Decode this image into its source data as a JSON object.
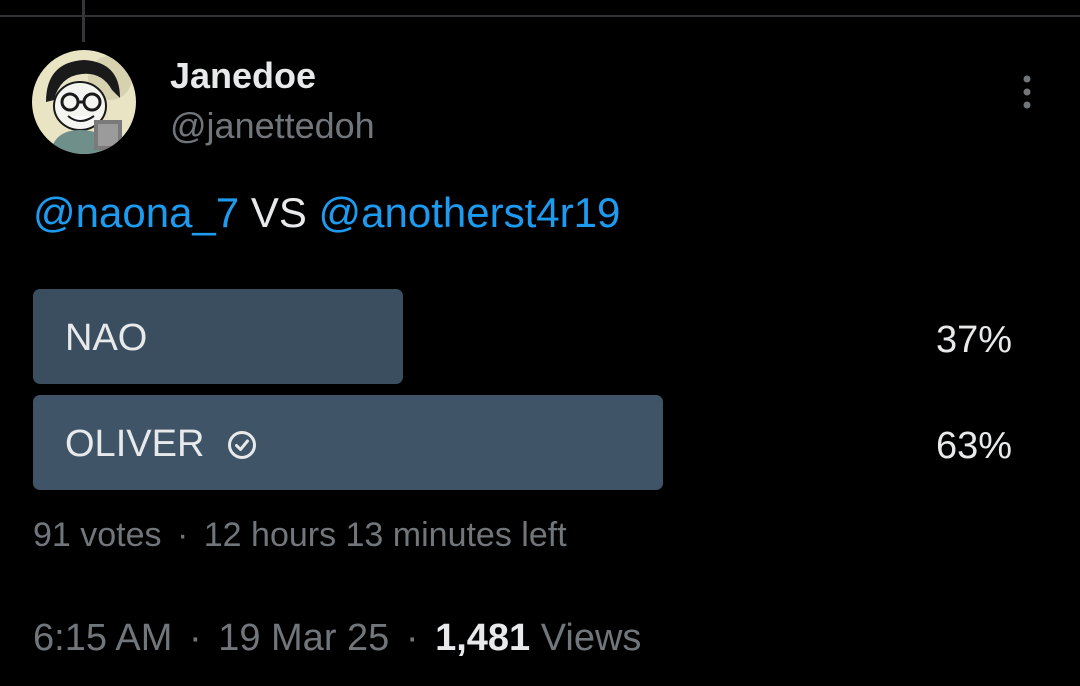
{
  "author": {
    "display_name": "Janedoe",
    "handle": "@janettedoh",
    "avatar_icon": "cartoon-avatar"
  },
  "more_icon": "vertical-ellipsis-icon",
  "tweet": {
    "mention_1": "@naona_7",
    "versus": "VS",
    "mention_2": "@anotherst4r19"
  },
  "poll": {
    "options": [
      {
        "label": "NAO",
        "percent": "37%",
        "value": 37,
        "winner": false
      },
      {
        "label": "OLIVER",
        "percent": "63%",
        "value": 63,
        "winner": true
      }
    ],
    "votes": "91 votes",
    "dot": "·",
    "time_left": "12 hours 13 minutes left"
  },
  "meta": {
    "time": "6:15 AM",
    "date": "19 Mar 25",
    "views_count": "1,481",
    "views_label": "Views",
    "dot": "·"
  },
  "colors": {
    "background": "#000000",
    "text_primary": "#e7e9ea",
    "text_secondary": "#71767b",
    "mention": "#1d9bf0",
    "poll_bar": "#3b4e5f"
  }
}
